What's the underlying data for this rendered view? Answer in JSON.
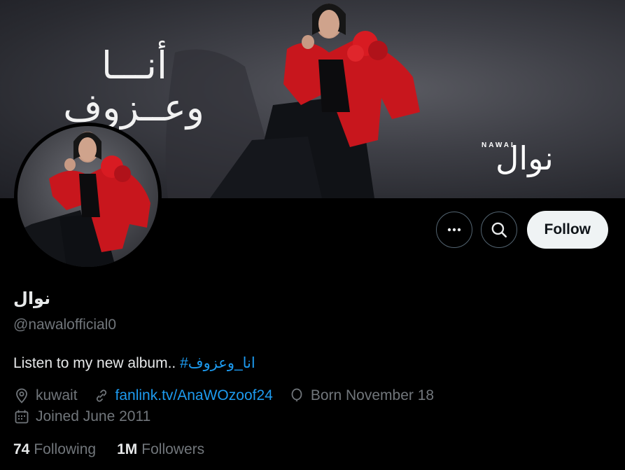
{
  "banner": {
    "title_ar": "أنـــا وعــزوف",
    "brand_en": "NAWAL",
    "brand_ar": "نوال"
  },
  "actions": {
    "more_icon": "more-horizontal-icon",
    "search_icon": "search-icon",
    "follow_label": "Follow"
  },
  "profile": {
    "display_name": "نوال",
    "handle": "@nawalofficial0",
    "bio_text": "Listen to my new album.. ",
    "bio_hashtag": "#انا_وعزوف",
    "location": "kuwait",
    "website": "fanlink.tv/AnaWOzoof24",
    "birthday": "Born November 18",
    "joined": "Joined June 2011"
  },
  "stats": {
    "following_count": "74",
    "following_label": "Following",
    "followers_count": "1M",
    "followers_label": "Followers"
  },
  "colors": {
    "background": "#000000",
    "link": "#1d9bf0",
    "muted": "#71767b",
    "jacket_red": "#c8161d"
  }
}
